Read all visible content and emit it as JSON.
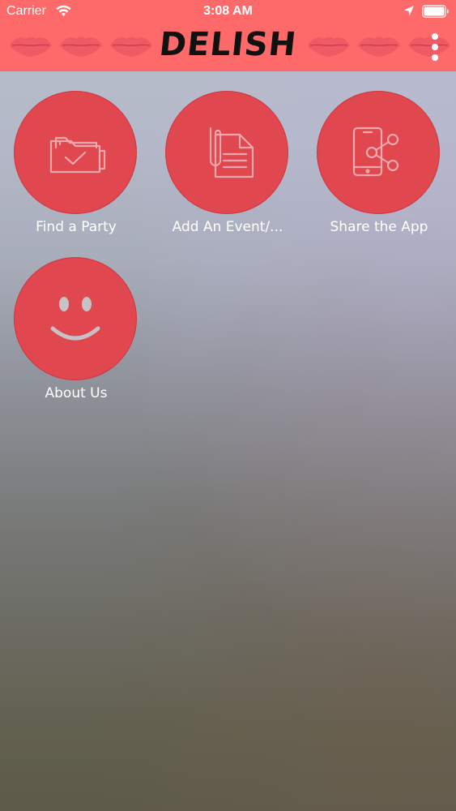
{
  "status_bar": {
    "carrier": "Carrier",
    "time": "3:08 AM",
    "icons": [
      "wifi-icon",
      "location-arrow-icon",
      "battery-icon"
    ]
  },
  "header": {
    "title": "DELISH",
    "menu_icon": "more-vertical-icon",
    "background_color": "#fe6a6a",
    "pattern": "lips"
  },
  "tiles": [
    {
      "label": "Find a Party",
      "icon": "folder-check-icon"
    },
    {
      "label": "Add An Event/...",
      "icon": "document-paperclip-icon"
    },
    {
      "label": "Share the App",
      "icon": "phone-share-icon"
    },
    {
      "label": "About Us",
      "icon": "smiley-face-icon"
    }
  ],
  "colors": {
    "tile_circle": "#e0474f",
    "icon_line": "#f0a8ac",
    "label_text": "#ffffff"
  }
}
